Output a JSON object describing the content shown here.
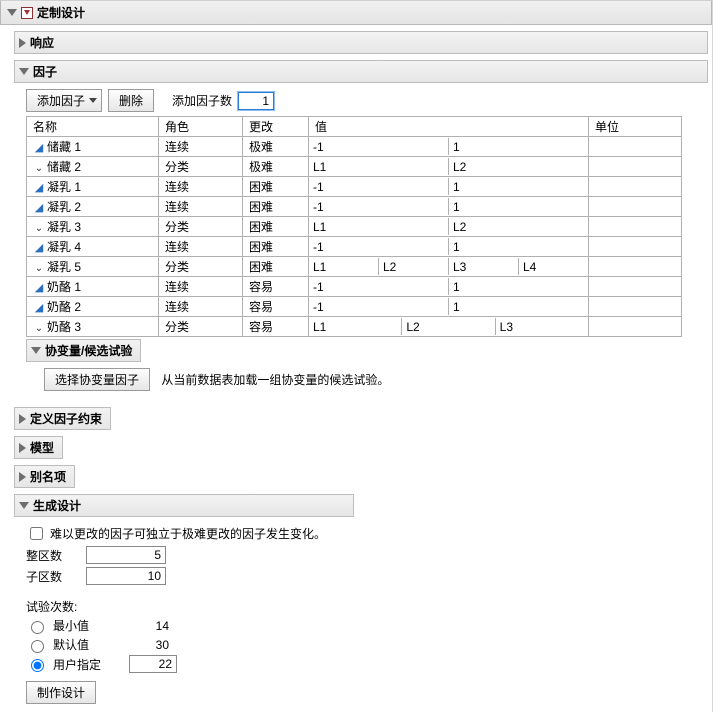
{
  "top": {
    "title": "定制设计"
  },
  "response": {
    "title": "响应"
  },
  "factors": {
    "title": "因子",
    "toolbar": {
      "add_label": "添加因子",
      "remove_label": "删除",
      "add_n_label": "添加因子数",
      "add_n_value": "1"
    },
    "columns": {
      "name": "名称",
      "role": "角色",
      "change": "更改",
      "value": "值",
      "unit": "单位"
    },
    "rows": [
      {
        "glyph": "tri",
        "name": "储藏 1",
        "role": "连续",
        "change": "极难",
        "values": [
          "-1",
          "1"
        ],
        "cols": 2
      },
      {
        "glyph": "caret",
        "name": "储藏 2",
        "role": "分类",
        "change": "极难",
        "values": [
          "L1",
          "L2"
        ],
        "cols": 2
      },
      {
        "glyph": "tri",
        "name": "凝乳 1",
        "role": "连续",
        "change": "困难",
        "values": [
          "-1",
          "1"
        ],
        "cols": 2
      },
      {
        "glyph": "tri",
        "name": "凝乳 2",
        "role": "连续",
        "change": "困难",
        "values": [
          "-1",
          "1"
        ],
        "cols": 2
      },
      {
        "glyph": "caret",
        "name": "凝乳 3",
        "role": "分类",
        "change": "困难",
        "values": [
          "L1",
          "L2"
        ],
        "cols": 2
      },
      {
        "glyph": "tri",
        "name": "凝乳 4",
        "role": "连续",
        "change": "困难",
        "values": [
          "-1",
          "1"
        ],
        "cols": 2
      },
      {
        "glyph": "caret",
        "name": "凝乳 5",
        "role": "分类",
        "change": "困难",
        "values": [
          "L1",
          "L2",
          "L3",
          "L4"
        ],
        "cols": 4
      },
      {
        "glyph": "tri",
        "name": "奶酪 1",
        "role": "连续",
        "change": "容易",
        "values": [
          "-1",
          "1"
        ],
        "cols": 2
      },
      {
        "glyph": "tri",
        "name": "奶酪 2",
        "role": "连续",
        "change": "容易",
        "values": [
          "-1",
          "1"
        ],
        "cols": 2
      },
      {
        "glyph": "caret",
        "name": "奶酪 3",
        "role": "分类",
        "change": "容易",
        "values": [
          "L1",
          "L2",
          "L3"
        ],
        "cols": 3
      }
    ]
  },
  "covariate": {
    "title": "协变量/候选试验",
    "button": "选择协变量因子",
    "note": "从当前数据表加载一组协变量的候选试验。"
  },
  "define": {
    "title": "定义因子约束"
  },
  "model": {
    "title": "模型"
  },
  "alias": {
    "title": "别名项"
  },
  "generate": {
    "title": "生成设计",
    "checkbox_label": "难以更改的因子可独立于极难更改的因子发生变化。",
    "whole_label": "整区数",
    "whole_value": "5",
    "sub_label": "子区数",
    "sub_value": "10",
    "runs_label": "试验次数:",
    "min_label": "最小值",
    "min_value": "14",
    "default_label": "默认值",
    "default_value": "30",
    "user_label": "用户指定",
    "user_value": "22",
    "make_button": "制作设计"
  }
}
